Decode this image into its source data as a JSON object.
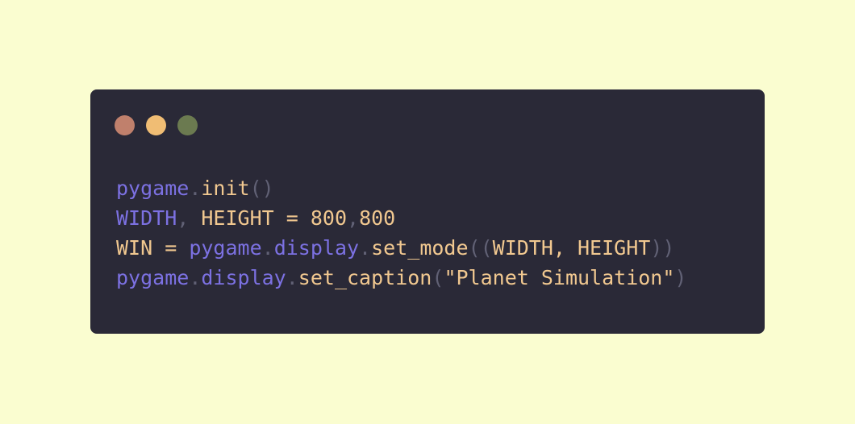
{
  "theme": {
    "background": "#fafdd0",
    "window_bg": "#2a2937",
    "keyword_purple": "#7c71e2",
    "text_orange": "#f1c890",
    "punct_gray": "#616175"
  },
  "window_controls": [
    {
      "name": "close",
      "color": "#c0806c"
    },
    {
      "name": "minimize",
      "color": "#f0bd74"
    },
    {
      "name": "maximize",
      "color": "#6b7a50"
    }
  ],
  "code_lines": [
    [
      {
        "text": "pygame",
        "kind": "purple"
      },
      {
        "text": ".",
        "kind": "gray"
      },
      {
        "text": "init",
        "kind": "orange"
      },
      {
        "text": "()",
        "kind": "gray"
      }
    ],
    [
      {
        "text": "WIDTH",
        "kind": "purple"
      },
      {
        "text": ", ",
        "kind": "gray"
      },
      {
        "text": "HEIGHT = 800",
        "kind": "orange"
      },
      {
        "text": ",",
        "kind": "gray"
      },
      {
        "text": "800",
        "kind": "orange"
      }
    ],
    [
      {
        "text": "WIN = ",
        "kind": "orange"
      },
      {
        "text": "pygame",
        "kind": "purple"
      },
      {
        "text": ".",
        "kind": "gray"
      },
      {
        "text": "display",
        "kind": "purple"
      },
      {
        "text": ".",
        "kind": "gray"
      },
      {
        "text": "set_mode",
        "kind": "orange"
      },
      {
        "text": "((",
        "kind": "gray"
      },
      {
        "text": "WIDTH, HEIGHT",
        "kind": "orange"
      },
      {
        "text": "))",
        "kind": "gray"
      }
    ],
    [
      {
        "text": "pygame",
        "kind": "purple"
      },
      {
        "text": ".",
        "kind": "gray"
      },
      {
        "text": "display",
        "kind": "purple"
      },
      {
        "text": ".",
        "kind": "gray"
      },
      {
        "text": "set_caption",
        "kind": "orange"
      },
      {
        "text": "(",
        "kind": "gray"
      },
      {
        "text": "\"Planet Simulation\"",
        "kind": "orange"
      },
      {
        "text": ")",
        "kind": "gray"
      }
    ]
  ]
}
